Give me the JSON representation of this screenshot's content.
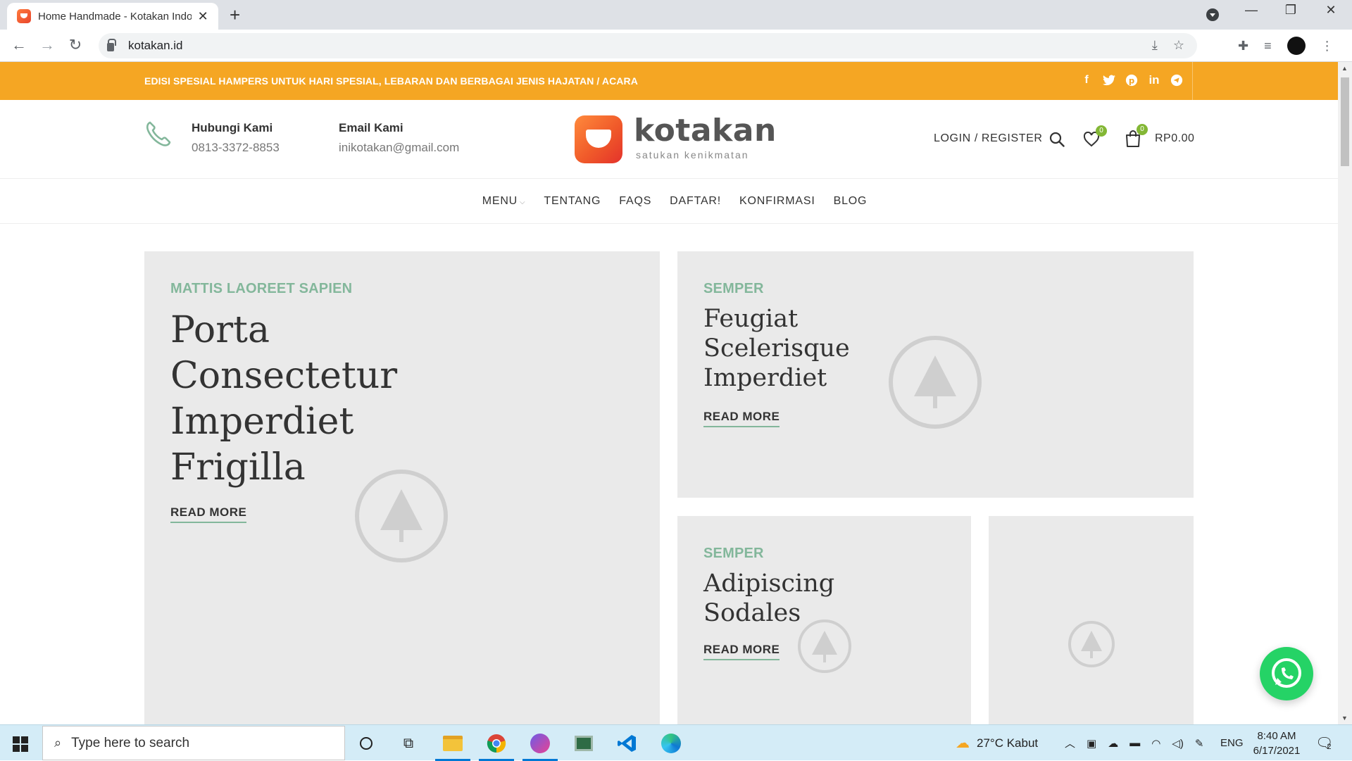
{
  "browser": {
    "tab_title": "Home Handmade - Kotakan Indo",
    "new_tab": "+",
    "url": "kotakan.id",
    "window_controls": {
      "minimize": "—",
      "restore": "❐",
      "close": "✕"
    }
  },
  "topbar": {
    "announcement": "EDISI SPESIAL HAMPERS UNTUK HARI SPESIAL, LEBARAN DAN BERBAGAI JENIS HAJATAN / ACARA",
    "socials": [
      "facebook-icon",
      "twitter-icon",
      "pinterest-icon",
      "linkedin-icon",
      "telegram-icon"
    ],
    "color": "#f5a623"
  },
  "header": {
    "phone_label": "Hubungi Kami",
    "phone_value": "0813-3372-8853",
    "email_label": "Email Kami",
    "email_value": "inikotakan@gmail.com",
    "logo_word": "kotakan",
    "logo_tagline": "satukan kenikmatan",
    "login": "LOGIN / REGISTER",
    "wishlist_count": "0",
    "cart_count": "0",
    "cart_total": "RP0.00"
  },
  "nav": {
    "items": [
      {
        "label": "MENU",
        "has_dropdown": true
      },
      {
        "label": "TENTANG"
      },
      {
        "label": "FAQS"
      },
      {
        "label": "DAFTAR!"
      },
      {
        "label": "KONFIRMASI"
      },
      {
        "label": "BLOG"
      }
    ]
  },
  "posts": [
    {
      "category": "MATTIS LAOREET SAPIEN",
      "title": "Porta Consectetur Imperdiet Frigilla",
      "more": "READ MORE"
    },
    {
      "category": "SEMPER",
      "title": "Feugiat Scelerisque Imperdiet",
      "more": "READ MORE"
    },
    {
      "category": "SEMPER",
      "title": "Adipiscing Sodales",
      "more": "READ MORE"
    }
  ],
  "accent_color": "#83b79b",
  "taskbar": {
    "search_placeholder": "Type here to search",
    "weather": "27°C  Kabut",
    "language": "ENG",
    "time": "8:40 AM",
    "date": "6/17/2021",
    "notifications": "2"
  }
}
